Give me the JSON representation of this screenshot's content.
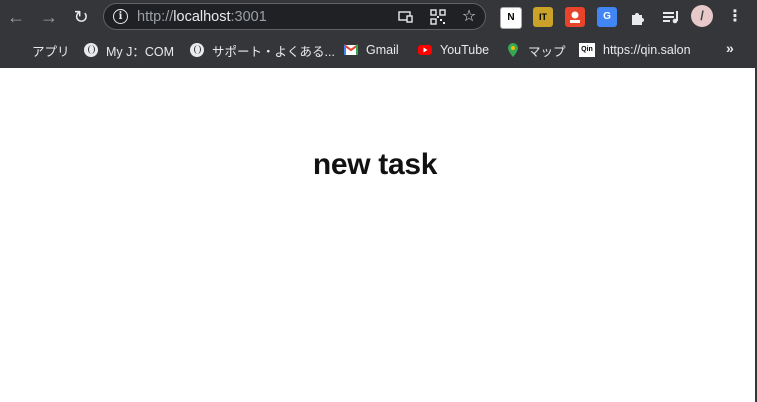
{
  "browser": {
    "url_scheme": "http://",
    "url_host": "localhost",
    "url_port": ":3001",
    "extensions": [
      {
        "icon": "notion-icon",
        "label": "N",
        "color": "#ffffff",
        "text_color": "#000000"
      },
      {
        "icon": "it-daigaku-icon",
        "label": "IT",
        "color": "#b8860b",
        "text_color": "#000000"
      },
      {
        "icon": "red-extension-icon",
        "label": "",
        "color": "#e8442c",
        "text_color": "#ffffff"
      },
      {
        "icon": "google-translate-icon",
        "label": "G",
        "color": "#4285f4",
        "text_color": "#ffffff"
      }
    ],
    "avatar_initial": "/"
  },
  "bookmarks": {
    "apps": "アプリ",
    "myjcom": "My J：COM",
    "support": "サポート・よくある...",
    "gmail": "Gmail",
    "youtube": "YouTube",
    "maps": "マップ",
    "qin_badge": "Qin",
    "qin": "https://qin.salon",
    "more": "»"
  },
  "page": {
    "title": "new task"
  },
  "colors": {
    "chrome_bg": "#35363a",
    "omnibox_bg": "#202124",
    "page_bg": "#ffffff",
    "title": "#111111"
  }
}
